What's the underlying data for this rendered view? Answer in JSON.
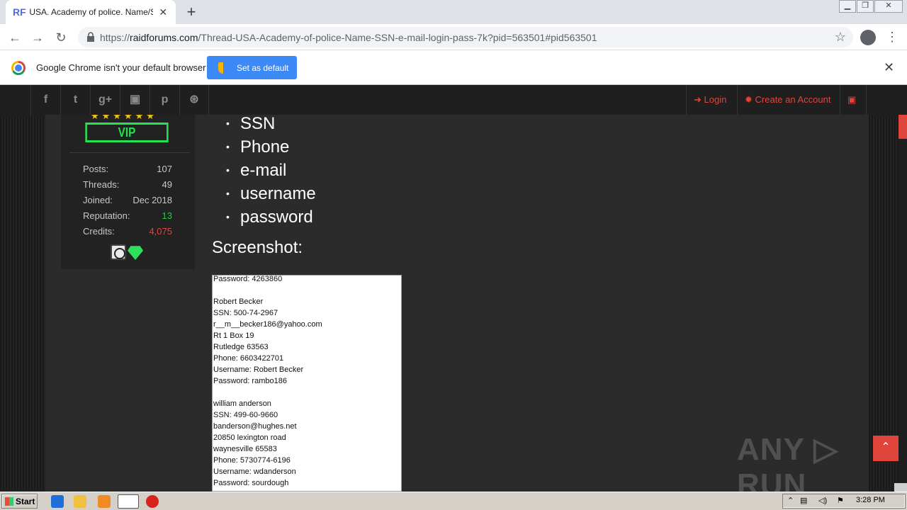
{
  "browser": {
    "tab_title": "USA. Academy of police. Name/SSN/",
    "favicon_text": "RF",
    "url_scheme": "https://",
    "url_host": "raidforums.com",
    "url_path": "/Thread-USA-Academy-of-police-Name-SSN-e-mail-login-pass-7k?pid=563501#pid563501"
  },
  "infobar": {
    "message": "Google Chrome isn't your default browser",
    "button_label": "Set as default"
  },
  "site_nav": {
    "social_icons": [
      "facebook-icon",
      "twitter-icon",
      "google-plus-icon",
      "youtube-icon",
      "pinterest-icon",
      "dribbble-icon"
    ],
    "social_glyphs": [
      "f",
      "t",
      "g+",
      "▣",
      "p",
      "⊛"
    ],
    "login_label": "Login",
    "register_label": "Create an Account"
  },
  "user": {
    "rank_label": "VIP",
    "stars": "★★★★★★",
    "stats": [
      {
        "label": "Posts:",
        "value": "107",
        "color": "#c8c8c8"
      },
      {
        "label": "Threads:",
        "value": "49",
        "color": "#c8c8c8"
      },
      {
        "label": "Joined:",
        "value": "Dec 2018",
        "color": "#c8c8c8"
      },
      {
        "label": "Reputation:",
        "value": "13",
        "color": "#27c93f"
      },
      {
        "label": "Credits:",
        "value": "4,075",
        "color": "#e0453c"
      }
    ]
  },
  "post": {
    "fields": [
      "SSN",
      "Phone",
      "e-mail",
      "username",
      "password"
    ],
    "screenshot_heading": "Screenshot:",
    "screenshot_lines": [
      "Password: 4263860",
      "",
      "Robert Becker",
      "SSN: 500-74-2967",
      "r__m__becker186@yahoo.com",
      "Rt 1 Box 19",
      "Rutledge 63563",
      "Phone: 6603422701",
      "Username: Robert Becker",
      "Password: rambo186",
      "",
      "william anderson",
      "SSN: 499-60-9660",
      "banderson@hughes.net",
      "20850 lexington road",
      "waynesville 65583",
      "Phone: 5730774-6196",
      "Username: wdanderson",
      "Password: sourdough"
    ]
  },
  "watermark": "ANY ▷ RUN",
  "taskbar": {
    "start_label": "Start",
    "clock": "3:28 PM"
  },
  "colors": {
    "accent": "#e0453c",
    "vip_green": "#27e24f"
  }
}
